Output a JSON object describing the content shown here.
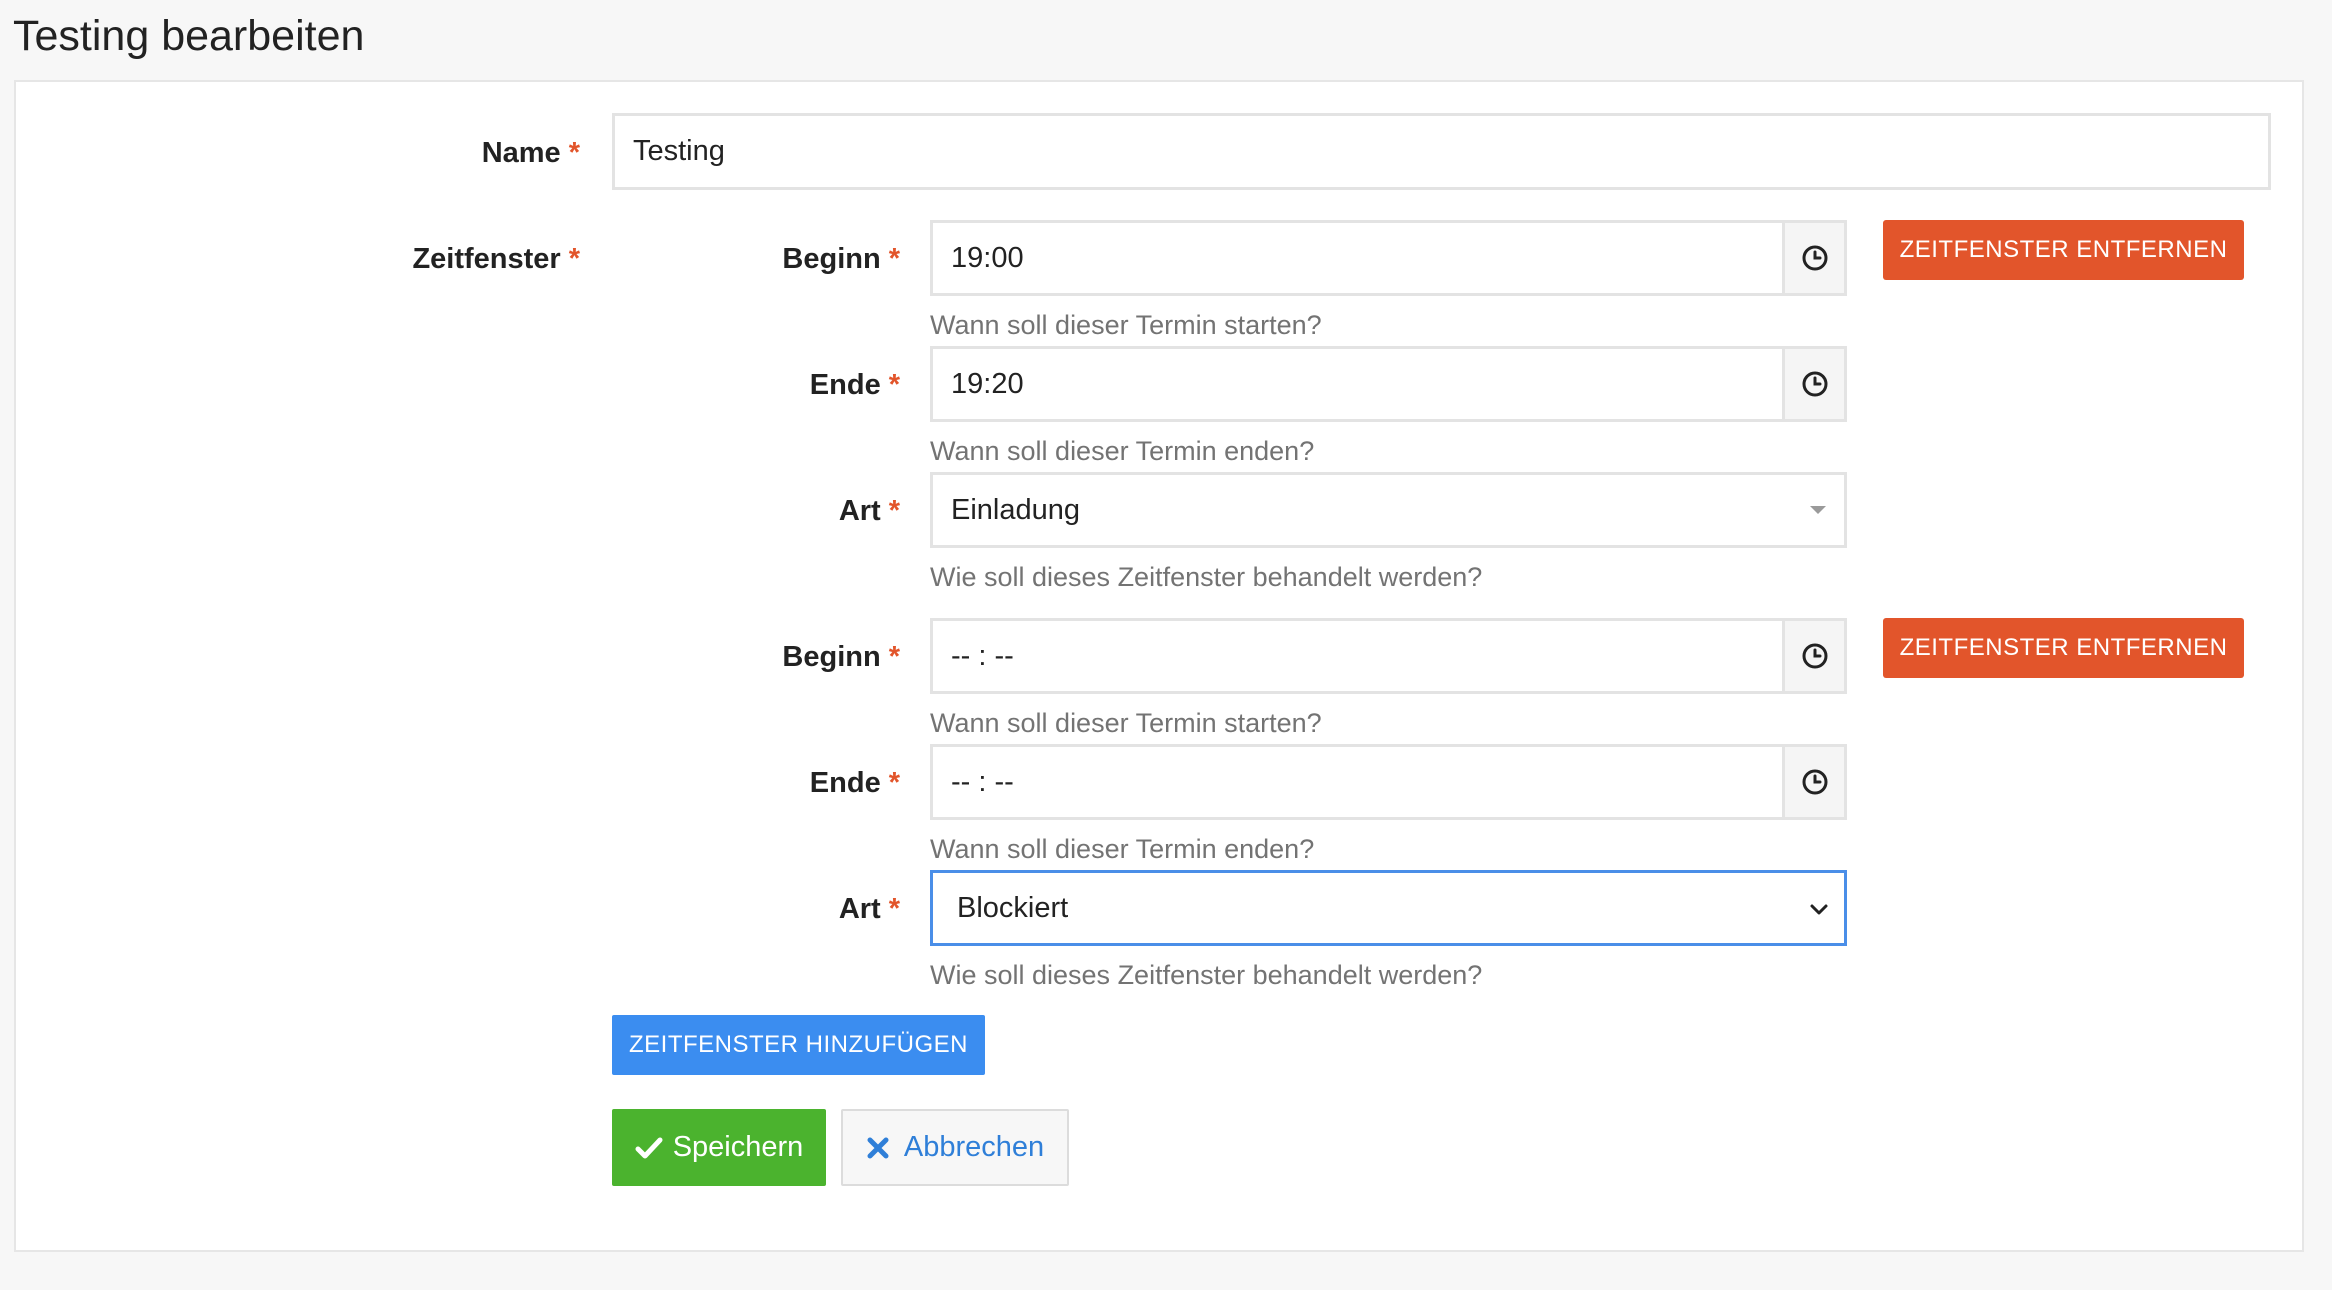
{
  "page": {
    "title": "Testing bearbeiten"
  },
  "form": {
    "required_mark": "*",
    "name": {
      "label": "Name",
      "value": "Testing"
    },
    "zeitfenster_label": "Zeitfenster",
    "slots": [
      {
        "begin": {
          "label": "Beginn",
          "value": "19:00",
          "help": "Wann soll dieser Termin starten?"
        },
        "end": {
          "label": "Ende",
          "value": "19:20",
          "help": "Wann soll dieser Termin enden?"
        },
        "type": {
          "label": "Art",
          "value": "Einladung",
          "help": "Wie soll dieses Zeitfenster behandelt werden?"
        },
        "remove_label": "ZEITFENSTER ENTFERNEN"
      },
      {
        "begin": {
          "label": "Beginn",
          "value": "-- : --",
          "help": "Wann soll dieser Termin starten?"
        },
        "end": {
          "label": "Ende",
          "value": "-- : --",
          "help": "Wann soll dieser Termin enden?"
        },
        "type": {
          "label": "Art",
          "value": "Blockiert",
          "help": "Wie soll dieses Zeitfenster behandelt werden?"
        },
        "remove_label": "ZEITFENSTER ENTFERNEN"
      }
    ],
    "add_slot_label": "ZEITFENSTER HINZUFÜGEN",
    "save_label": "Speichern",
    "cancel_label": "Abbrechen"
  },
  "icons": {
    "time": "clock-icon",
    "save": "check-icon",
    "cancel": "x-icon",
    "select_plain": "caret-down-icon",
    "select_focused": "chevron-down-icon"
  },
  "colors": {
    "danger": "#e2552b",
    "primary": "#3b8df0",
    "success": "#4bb32e",
    "link": "#2f7fd8",
    "focus": "#4a8ee8"
  }
}
